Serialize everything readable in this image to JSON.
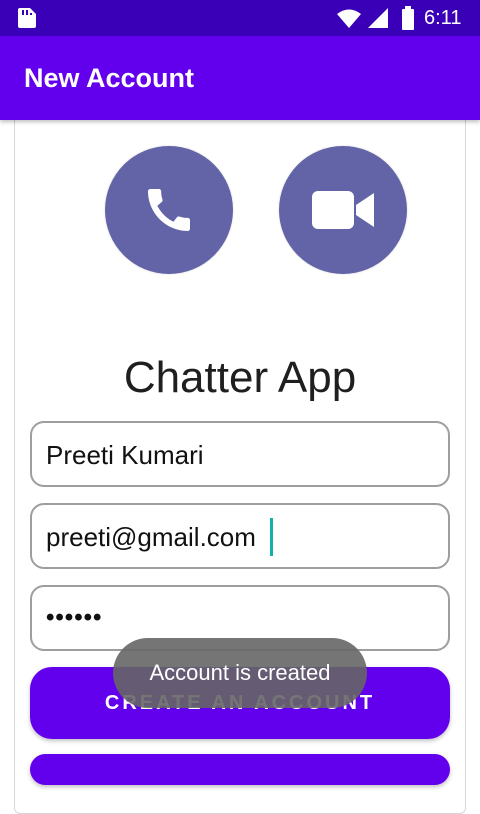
{
  "status_bar": {
    "time": "6:11",
    "icons": [
      "sd-card-icon",
      "wifi-icon",
      "signal-icon",
      "battery-icon"
    ]
  },
  "app_bar": {
    "title": "New Account",
    "background": "#6200ee"
  },
  "hero": {
    "buttons": [
      {
        "icon": "phone-icon",
        "color": "#6264a7"
      },
      {
        "icon": "video-camera-icon",
        "color": "#6264a7"
      }
    ],
    "app_name": "Chatter App"
  },
  "form": {
    "name_value": "Preeti Kumari",
    "email_value": "preeti@gmail.com",
    "password_mask": "••••••"
  },
  "actions": {
    "create_account_label": "CREATE AN ACCOUNT",
    "button_color": "#6200ee"
  },
  "toast": {
    "message": "Account is created"
  },
  "colors": {
    "status_bar": "#3a00b8",
    "accent": "#6200ee",
    "icon_circle": "#6264a7",
    "cursor": "#0fb2a8"
  }
}
